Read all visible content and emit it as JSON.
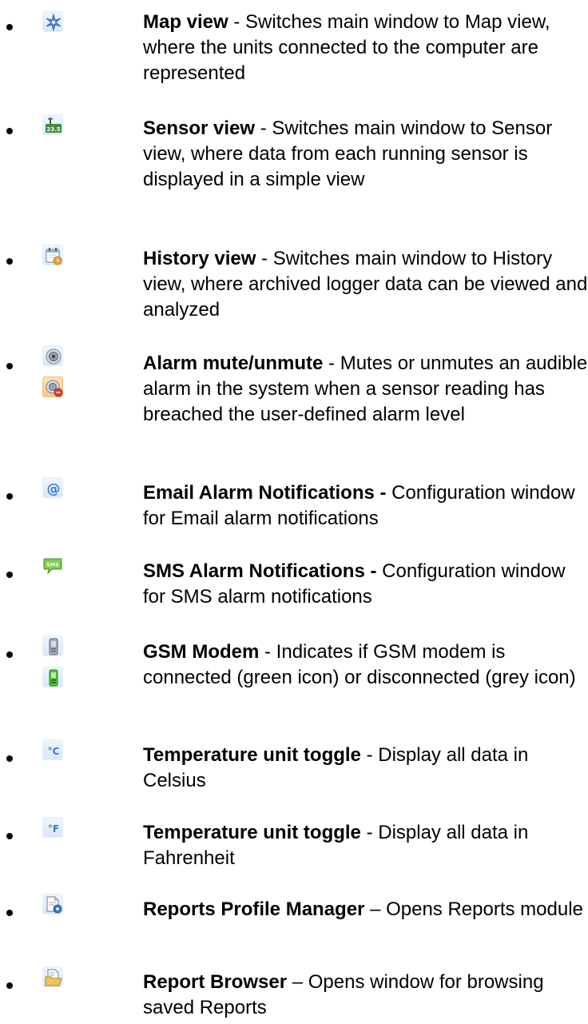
{
  "items": [
    {
      "title": "Map view",
      "description": " - Switches main window to Map view, where the units connected to the computer are represented",
      "icons": [
        "map-star-icon"
      ]
    },
    {
      "title": "Sensor view",
      "description": " - Switches main window to Sensor view, where data from each running sensor is displayed in a simple view",
      "icons": [
        "sensor-reading-icon"
      ]
    },
    {
      "title": "History view",
      "description": " - Switches main window to History view, where archived logger data can be viewed and analyzed",
      "icons": [
        "history-calendar-icon"
      ]
    },
    {
      "title": "Alarm mute/unmute",
      "description": " - Mutes or unmutes an audible alarm in the system when a sensor reading has breached the user-defined alarm level",
      "icons": [
        "alarm-speaker-icon",
        "alarm-muted-speaker-icon"
      ]
    },
    {
      "title": "Email Alarm Notifications -",
      "description": " Configuration window for Email alarm notifications",
      "icons": [
        "email-at-icon"
      ]
    },
    {
      "title": "SMS Alarm Notifications -",
      "description": " Configuration window for SMS alarm notifications",
      "icons": [
        "sms-bubble-icon"
      ]
    },
    {
      "title": "GSM Modem",
      "description": " - Indicates if GSM modem is connected (green icon) or disconnected (grey icon)",
      "icons": [
        "gsm-modem-grey-icon",
        "gsm-modem-green-icon"
      ]
    },
    {
      "title": "Temperature unit toggle",
      "description": " - Display all data in Celsius",
      "icons": [
        "celsius-icon"
      ]
    },
    {
      "title": "Temperature unit toggle",
      "description": " - Display all data in Fahrenheit",
      "icons": [
        "fahrenheit-icon"
      ]
    },
    {
      "title": "Reports Profile Manager",
      "description": " – Opens Reports module",
      "icons": [
        "reports-profile-manager-icon"
      ]
    },
    {
      "title": "Report Browser",
      "description": " – Opens window for browsing saved Reports",
      "icons": [
        "report-browser-folder-icon"
      ]
    }
  ],
  "icon_text": {
    "sensor_reading": "23.5",
    "sms": "SMS",
    "celsius": "°C",
    "fahrenheit": "°F"
  },
  "colors": {
    "text": "#000000",
    "background": "#ffffff",
    "icon_blue": "#3f78c9",
    "icon_green": "#2e9e2d",
    "alarm_red": "#e43c2f"
  }
}
